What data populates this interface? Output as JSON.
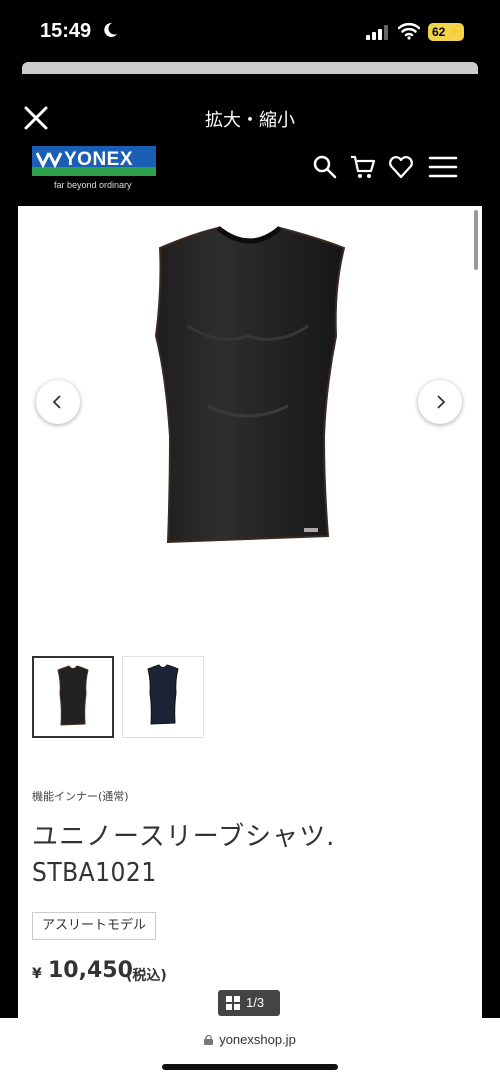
{
  "status_bar": {
    "time": "15:49",
    "battery": "62"
  },
  "viewer": {
    "title": "拡大・縮小"
  },
  "site": {
    "logo_text": "YONEX",
    "tagline": "far beyond ordinary"
  },
  "product": {
    "category": "機能インナー(通常)",
    "name": "ユニノースリーブシャツ.",
    "code": "STBA1021",
    "tag": "アスリートモデル",
    "currency": "¥",
    "price": "10,450",
    "tax_label": "(税込)"
  },
  "gallery": {
    "page_indicator": "1/3",
    "thumbnails": [
      "black",
      "navy"
    ]
  },
  "browser": {
    "url": "yonexshop.jp"
  },
  "colors": {
    "brand_blue": "#1a5fb4",
    "brand_green": "#2ea04a",
    "battery": "#f3d34a"
  },
  "icons": [
    "moon-icon",
    "signal-icon",
    "wifi-icon",
    "close-icon",
    "search-icon",
    "cart-icon",
    "heart-icon",
    "menu-icon",
    "chevron-left-icon",
    "chevron-right-icon",
    "grid-icon",
    "lock-icon"
  ]
}
